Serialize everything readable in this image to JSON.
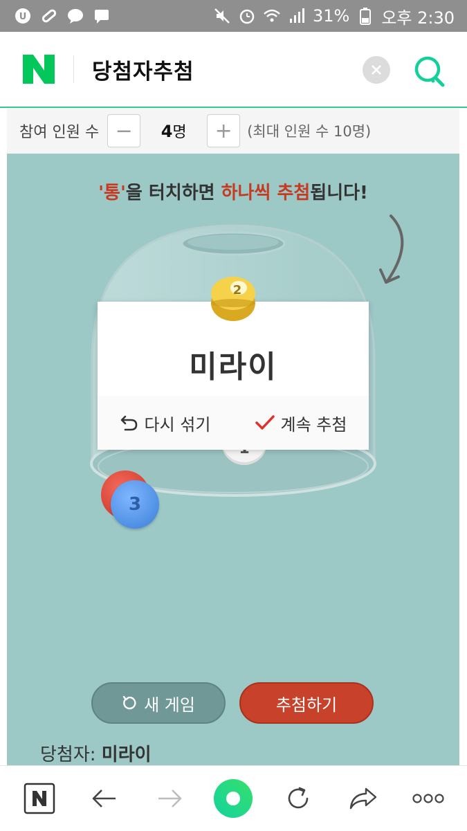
{
  "status_bar": {
    "battery": "31%",
    "time": "오후 2:30"
  },
  "header": {
    "logo": "N",
    "title": "당첨자추첨",
    "icons": [
      "close-icon",
      "search-icon"
    ]
  },
  "participants": {
    "label": "참여 인원 수",
    "minus": "−",
    "count": "4",
    "unit": "명",
    "plus": "+",
    "max_note": "(최대 인원 수 10명)"
  },
  "game": {
    "instruction": {
      "q_open": "'",
      "jar_word": "통",
      "q_close": "'",
      "part1": "을 터치하면 ",
      "highlight": "하나씩 추첨",
      "part2": "됩니다!"
    },
    "result": {
      "ball_number": "2",
      "winner": "미라이",
      "reshuffle": "다시 섞기",
      "continue": "계속 추첨"
    },
    "balls": [
      {
        "number": "3",
        "color": "#4a90e2"
      },
      {
        "number": "",
        "color": "#e24a3a"
      },
      {
        "number": "1",
        "color": "#ffffff"
      }
    ],
    "new_game": "새 게임",
    "draw": "추첨하기",
    "winners_label": "당첨자:",
    "winners_value": "미라이"
  },
  "colors": {
    "accent_green": "#2ecc8c",
    "naver_green": "#03c75a",
    "game_bg": "#9cc8c6",
    "highlight_red": "#c63a22"
  }
}
